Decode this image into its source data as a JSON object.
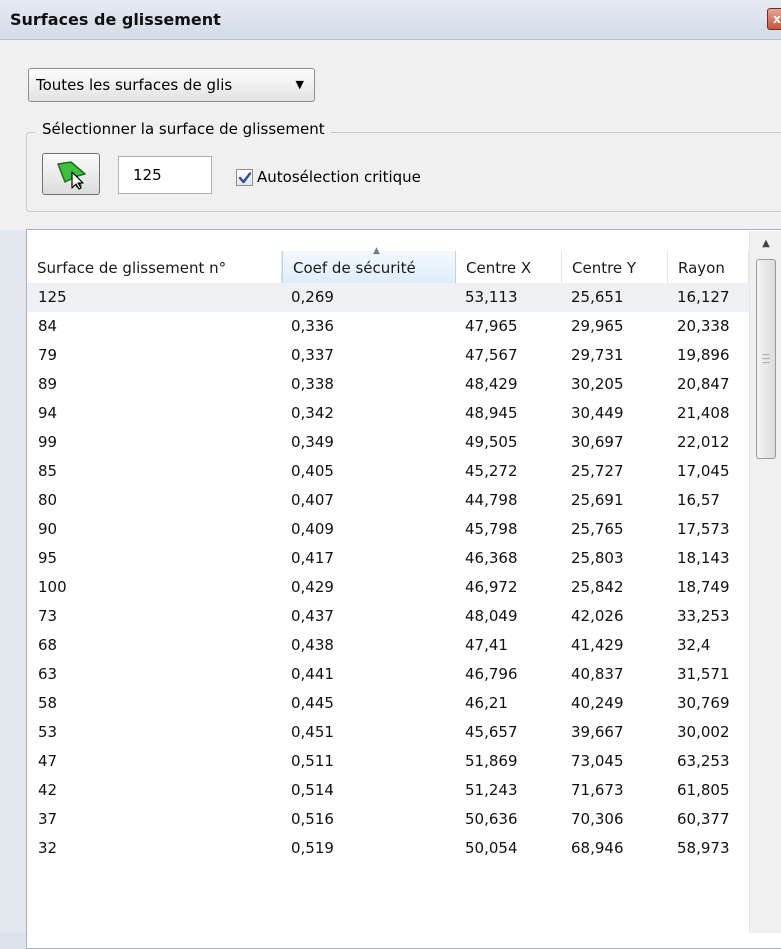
{
  "window": {
    "title": "Surfaces de glissement",
    "close_glyph": "x"
  },
  "filter": {
    "selected": "Toutes les surfaces de glis",
    "arrow": "▼"
  },
  "selection_group": {
    "legend": "Sélectionner la surface de glissement",
    "select_tool_icon": "pointer-arrow-icon",
    "surface_number": "125",
    "auto_select_checked": true,
    "auto_select_label": "Autosélection critique"
  },
  "table": {
    "columns": [
      "Surface de glissement n°",
      "Coef de sécurité",
      "Centre X",
      "Centre Y",
      "Rayon"
    ],
    "sorted_column": "Coef de sécurité",
    "sort_indicator": "▲",
    "selected_row": 0,
    "rows": [
      [
        "125",
        "0,269",
        "53,113",
        "25,651",
        "16,127"
      ],
      [
        "84",
        "0,336",
        "47,965",
        "29,965",
        "20,338"
      ],
      [
        "79",
        "0,337",
        "47,567",
        "29,731",
        "19,896"
      ],
      [
        "89",
        "0,338",
        "48,429",
        "30,205",
        "20,847"
      ],
      [
        "94",
        "0,342",
        "48,945",
        "30,449",
        "21,408"
      ],
      [
        "99",
        "0,349",
        "49,505",
        "30,697",
        "22,012"
      ],
      [
        "85",
        "0,405",
        "45,272",
        "25,727",
        "17,045"
      ],
      [
        "80",
        "0,407",
        "44,798",
        "25,691",
        "16,57"
      ],
      [
        "90",
        "0,409",
        "45,798",
        "25,765",
        "17,573"
      ],
      [
        "95",
        "0,417",
        "46,368",
        "25,803",
        "18,143"
      ],
      [
        "100",
        "0,429",
        "46,972",
        "25,842",
        "18,749"
      ],
      [
        "73",
        "0,437",
        "48,049",
        "42,026",
        "33,253"
      ],
      [
        "68",
        "0,438",
        "47,41",
        "41,429",
        "32,4"
      ],
      [
        "63",
        "0,441",
        "46,796",
        "40,837",
        "31,571"
      ],
      [
        "58",
        "0,445",
        "46,21",
        "40,249",
        "30,769"
      ],
      [
        "53",
        "0,451",
        "45,657",
        "39,667",
        "30,002"
      ],
      [
        "47",
        "0,511",
        "51,869",
        "73,045",
        "63,253"
      ],
      [
        "42",
        "0,514",
        "51,243",
        "71,673",
        "61,805"
      ],
      [
        "37",
        "0,516",
        "50,636",
        "70,306",
        "60,377"
      ],
      [
        "32",
        "0,519",
        "50,054",
        "68,946",
        "58,973"
      ]
    ]
  },
  "scrollbar": {
    "up_arrow": "▲"
  },
  "colors": {
    "header_sorted_bg": "#dcecfb",
    "selected_row_bg": "#eef0f3",
    "tool_icon_green": "#3fbf3f"
  }
}
